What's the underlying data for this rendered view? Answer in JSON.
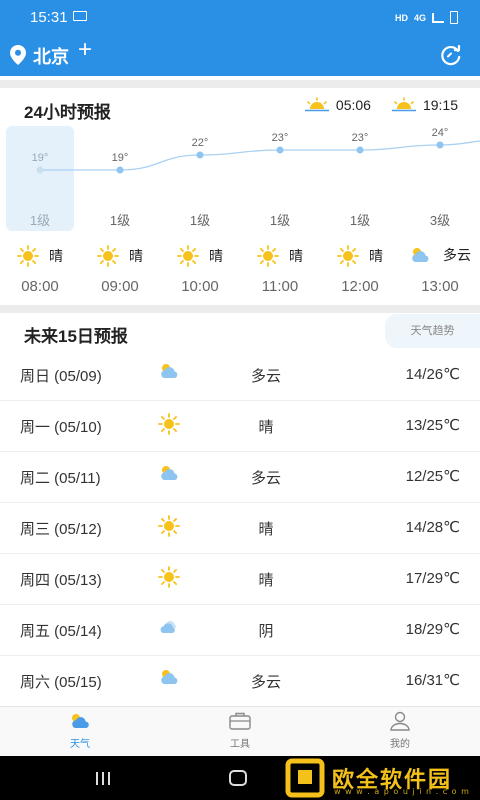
{
  "status_bar": {
    "time": "15:31",
    "network": "HD",
    "signal": "4G"
  },
  "header": {
    "city": "北京",
    "add_symbol": "+"
  },
  "hourly": {
    "title": "24小时预报",
    "sunrise": "05:06",
    "sunset": "19:15",
    "items": [
      {
        "time": "08:00",
        "temp": "19°",
        "wind": "1级",
        "condition": "晴",
        "icon": "sunny-icon"
      },
      {
        "time": "09:00",
        "temp": "19°",
        "wind": "1级",
        "condition": "晴",
        "icon": "sunny-icon"
      },
      {
        "time": "10:00",
        "temp": "22°",
        "wind": "1级",
        "condition": "晴",
        "icon": "sunny-icon"
      },
      {
        "time": "11:00",
        "temp": "23°",
        "wind": "1级",
        "condition": "晴",
        "icon": "sunny-icon"
      },
      {
        "time": "12:00",
        "temp": "23°",
        "wind": "1级",
        "condition": "晴",
        "icon": "sunny-icon"
      },
      {
        "time": "13:00",
        "temp": "24°",
        "wind": "3级",
        "condition": "多云",
        "icon": "cloudy-icon"
      }
    ]
  },
  "daily": {
    "title": "未来15日预报",
    "trend_button": "天气趋势",
    "items": [
      {
        "date": "周日 (05/09)",
        "condition": "多云",
        "temp": "14/26℃",
        "icon": "cloudy-icon"
      },
      {
        "date": "周一 (05/10)",
        "condition": "晴",
        "temp": "13/25℃",
        "icon": "sunny-icon"
      },
      {
        "date": "周二 (05/11)",
        "condition": "多云",
        "temp": "12/25℃",
        "icon": "cloudy-icon"
      },
      {
        "date": "周三 (05/12)",
        "condition": "晴",
        "temp": "14/28℃",
        "icon": "sunny-icon"
      },
      {
        "date": "周四 (05/13)",
        "condition": "晴",
        "temp": "17/29℃",
        "icon": "sunny-icon"
      },
      {
        "date": "周五 (05/14)",
        "condition": "阴",
        "temp": "18/29℃",
        "icon": "overcast-icon"
      },
      {
        "date": "周六 (05/15)",
        "condition": "多云",
        "temp": "16/31℃",
        "icon": "cloudy-icon"
      }
    ]
  },
  "nav": {
    "weather": "天气",
    "tools": "工具",
    "mine": "我的"
  },
  "watermark": {
    "text": "欧全软件园",
    "sub": "w w w . a p o u j i n . c o m"
  },
  "colors": {
    "primary": "#2a90e6",
    "sun": "#f6c21b",
    "cloud": "#8ec5f0"
  }
}
